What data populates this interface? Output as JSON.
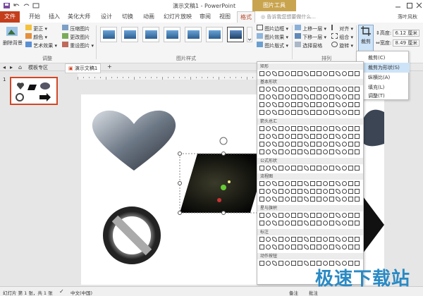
{
  "title_bar": {
    "title": "演示文稿1 - PowerPoint",
    "context_tab": "图片工具"
  },
  "tabs": [
    "文件",
    "开始",
    "插入",
    "美化大师",
    "设计",
    "切换",
    "动画",
    "幻灯片放映",
    "审阅",
    "视图",
    "格式"
  ],
  "active_tab": "格式",
  "search_placeholder": "告诉我您想要做什么...",
  "user_name": "落叶风秋",
  "ribbon": {
    "remove_bg": "删除背景",
    "adjust_group": [
      "更正 ▾",
      "颜色 ▾",
      "艺术效果 ▾"
    ],
    "adjust_group2": [
      "压缩图片",
      "更改图片",
      "重设图片 ▾"
    ],
    "adjust_label": "调整",
    "styles_label": "图片样式",
    "style_options": [
      "图片边框 ▾",
      "图片效果 ▾",
      "图片版式 ▾"
    ],
    "arrange_options": [
      "上移一层 ▾",
      "下移一层 ▾",
      "选择窗格"
    ],
    "arrange_options2": [
      "对齐 ▾",
      "组合 ▾",
      "旋转 ▾"
    ],
    "arrange_label": "排列",
    "crop": "裁剪",
    "height_label": "高度:",
    "height_value": "6.12 厘米",
    "width_label": "宽度:",
    "width_value": "8.49 厘米"
  },
  "doc_tabs": [
    "模板专区",
    "演示文稿1"
  ],
  "slide_number": "1",
  "crop_menu": [
    "裁剪(C)",
    "裁剪为形状(S)",
    "纵横比(A)",
    "填充(L)",
    "调整(T)"
  ],
  "shape_categories": [
    "矩形",
    "基本形状",
    "箭头总汇",
    "公式形状",
    "流程图",
    "星与旗帜",
    "标注",
    "动作按钮"
  ],
  "status": {
    "slide_info": "幻灯片 第 1 张，共 1 张",
    "language": "中文(中国)",
    "notes": "备注",
    "comments": "批注"
  },
  "watermark": "极速下载站",
  "colors": {
    "accent": "#c43e1c",
    "context": "#c9a44f",
    "highlight": "#cde3f7"
  }
}
